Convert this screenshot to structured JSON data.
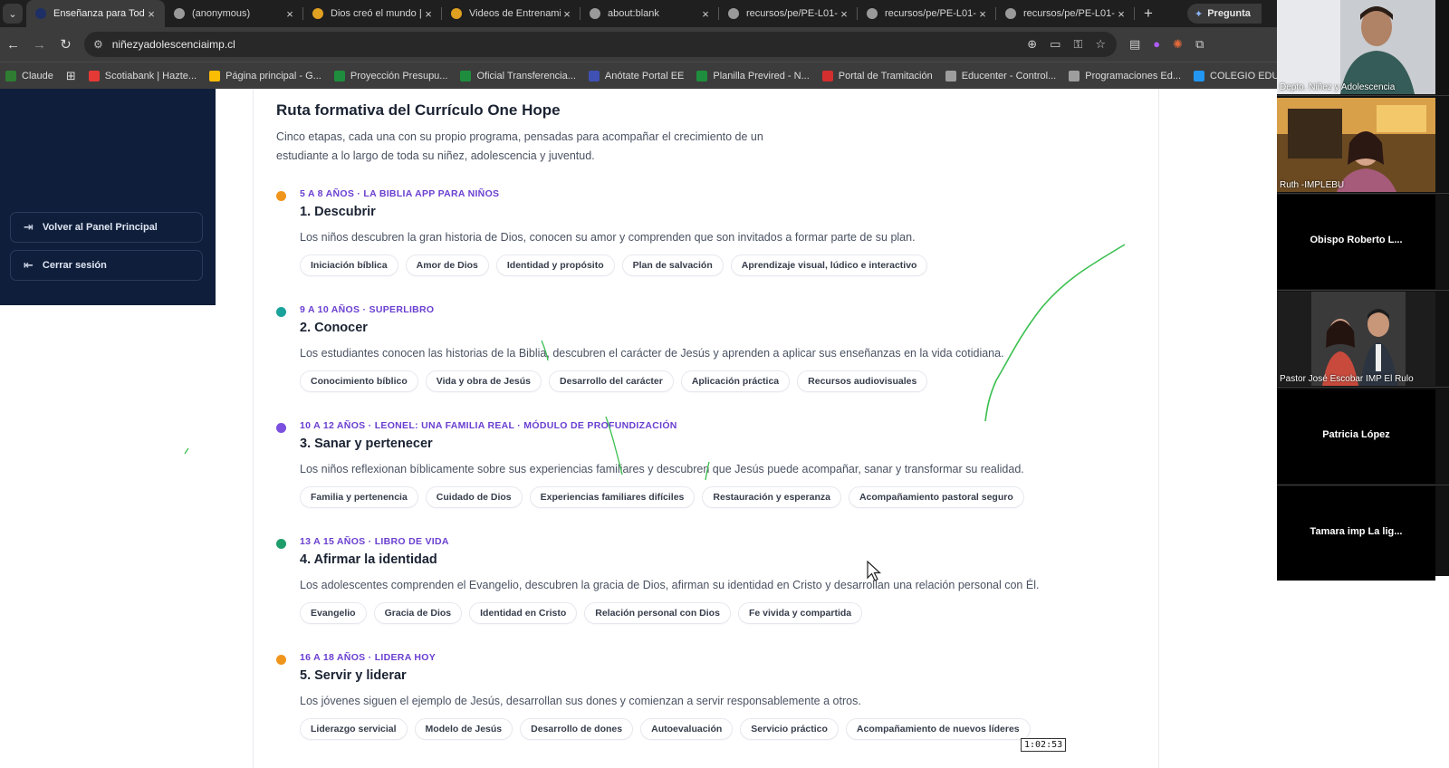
{
  "browser": {
    "tabs": [
      {
        "title": "Enseñanza para Todo",
        "favicon_color": "#1e2f66",
        "active": true
      },
      {
        "title": "(anonymous)",
        "favicon_color": "#9a9a9a",
        "active": false
      },
      {
        "title": "Dios creó el mundo |",
        "favicon_color": "#e0a020",
        "active": false
      },
      {
        "title": "Videos de Entrenamie",
        "favicon_color": "#e0a020",
        "active": false
      },
      {
        "title": "about:blank",
        "favicon_color": "#9a9a9a",
        "active": false
      },
      {
        "title": "recursos/pe/PE-L01-",
        "favicon_color": "#9a9a9a",
        "active": false
      },
      {
        "title": "recursos/pe/PE-L01-",
        "favicon_color": "#9a9a9a",
        "active": false
      },
      {
        "title": "recursos/pe/PE-L01-",
        "favicon_color": "#9a9a9a",
        "active": false
      }
    ],
    "ask_button_label": "Pregunta",
    "url": "niñezyadolescenciaimp.cl",
    "bookmarks": [
      {
        "label": "Claude",
        "color": "#2e7d32"
      },
      {
        "label": "Scotiabank | Hazte...",
        "color": "#e53935"
      },
      {
        "label": "Página principal - G...",
        "color": "#fbbc04"
      },
      {
        "label": "Proyección Presupu...",
        "color": "#1e8e3e"
      },
      {
        "label": "Oficial Transferencia...",
        "color": "#1e8e3e"
      },
      {
        "label": "Anótate Portal EE",
        "color": "#3f51b5"
      },
      {
        "label": "Planilla Previred - N...",
        "color": "#1e8e3e"
      },
      {
        "label": "Portal de Tramitación",
        "color": "#d32f2f"
      },
      {
        "label": "Educenter - Control...",
        "color": "#9e9e9e"
      },
      {
        "label": "Programaciones Ed...",
        "color": "#9e9e9e"
      },
      {
        "label": "COLEGIO EDUCENT...",
        "color": "#2196f3"
      }
    ]
  },
  "sidebar": {
    "back_label": "Volver al Panel Principal",
    "logout_label": "Cerrar sesión"
  },
  "page": {
    "title": "Ruta formativa del Currículo One Hope",
    "description": "Cinco etapas, cada una con su propio programa, pensadas para acompañar el crecimiento de un estudiante a lo largo de toda su niñez, adolescencia y juventud."
  },
  "stages": [
    {
      "age": "5 A 8 AÑOS · LA BIBLIA APP PARA NIÑOS",
      "title": "1. Descubrir",
      "text": "Los niños descubren la gran historia de Dios, conocen su amor y comprenden que son invitados a formar parte de su plan.",
      "dot_color": "#f0951c",
      "tags": [
        "Iniciación bíblica",
        "Amor de Dios",
        "Identidad y propósito",
        "Plan de salvación",
        "Aprendizaje visual, lúdico e interactivo"
      ]
    },
    {
      "age": "9 A 10 AÑOS · SUPERLIBRO",
      "title": "2. Conocer",
      "text": "Los estudiantes conocen las historias de la Biblia, descubren el carácter de Jesús y aprenden a aplicar sus enseñanzas en la vida cotidiana.",
      "dot_color": "#1aa39a",
      "tags": [
        "Conocimiento bíblico",
        "Vida y obra de Jesús",
        "Desarrollo del carácter",
        "Aplicación práctica",
        "Recursos audiovisuales"
      ]
    },
    {
      "age": "10 A 12 AÑOS · LEONEL: UNA FAMILIA REAL · MÓDULO DE PROFUNDIZACIÓN",
      "title": "3. Sanar y pertenecer",
      "text": "Los niños reflexionan bíblicamente sobre sus experiencias familiares y descubren que Jesús puede acompañar, sanar y transformar su realidad.",
      "dot_color": "#7b4fe0",
      "tags": [
        "Familia y pertenencia",
        "Cuidado de Dios",
        "Experiencias familiares difíciles",
        "Restauración y esperanza",
        "Acompañamiento pastoral seguro"
      ]
    },
    {
      "age": "13 A 15 AÑOS · LIBRO DE VIDA",
      "title": "4. Afirmar la identidad",
      "text": "Los adolescentes comprenden el Evangelio, descubren la gracia de Dios, afirman su identidad en Cristo y desarrollan una relación personal con Él.",
      "dot_color": "#1f9d6b",
      "tags": [
        "Evangelio",
        "Gracia de Dios",
        "Identidad en Cristo",
        "Relación personal con Dios",
        "Fe vivida y compartida"
      ]
    },
    {
      "age": "16 A 18 AÑOS · LIDERA HOY",
      "title": "5. Servir y liderar",
      "text": "Los jóvenes siguen el ejemplo de Jesús, desarrollan sus dones y comienzan a servir responsablemente a otros.",
      "dot_color": "#f0951c",
      "tags": [
        "Liderazgo servicial",
        "Modelo de Jesús",
        "Desarrollo de dones",
        "Autoevaluación",
        "Servicio práctico",
        "Acompañamiento de nuevos líderes"
      ]
    }
  ],
  "participants": [
    {
      "name": "Depto. Niñez y Adolescencia",
      "has_video": true
    },
    {
      "name": "Ruth -IMPLEBU",
      "has_video": true
    },
    {
      "name": "Obispo Roberto L...",
      "has_video": false
    },
    {
      "name": "Pastor José Escobar IMP El Rulo",
      "has_video": true
    },
    {
      "name": "Patricia López",
      "has_video": false
    },
    {
      "name": "Tamara imp La lig...",
      "has_video": false
    }
  ],
  "timestamp": "1:02:53"
}
